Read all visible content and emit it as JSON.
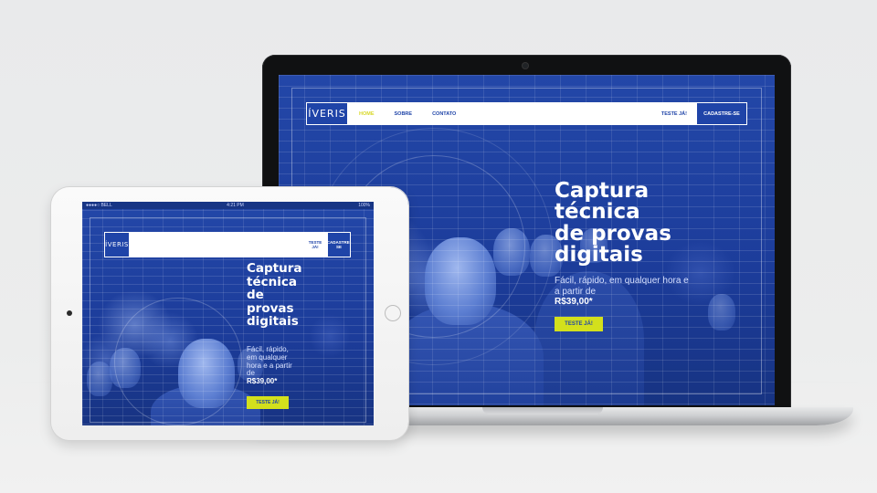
{
  "site": {
    "logo": "ÍVERIS",
    "nav": {
      "home": "HOME",
      "about": "SOBRE",
      "contact": "CONTATO",
      "try": "TESTE JÁ!",
      "signup": "CADASTRE-SE"
    },
    "hero": {
      "title_lines": [
        "Captura",
        "técnica",
        "de provas",
        "digitais"
      ],
      "subtitle": "Fácil, rápido, em qualquer hora e a partir de",
      "price": "R$39,00*",
      "cta": "TESTE JÁ!"
    }
  },
  "tablet": {
    "nav": {
      "try": "TESTE JÁ!",
      "signup": "CADASTRE-SE"
    },
    "hero": {
      "title_lines": [
        "Captura",
        "técnica",
        "de",
        "provas",
        "digitais"
      ],
      "subtitle": "Fácil, rápido, em qualquer hora e a partir de",
      "price": "R$39,00*",
      "cta": "TESTE JÁ!"
    },
    "status": {
      "carrier": "●●●●○ BELL",
      "time": "4:21 PM",
      "battery": "100%"
    }
  },
  "colors": {
    "brand_blue": "#1f44a8",
    "accent_yellow": "#d3e01c",
    "nav_active": "#d8d82a"
  }
}
